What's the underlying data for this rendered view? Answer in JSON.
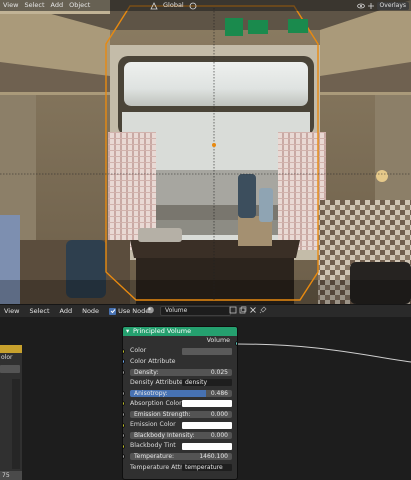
{
  "viewport_header": {
    "menus": [
      "View",
      "Select",
      "Add",
      "Object"
    ],
    "orientation": "Global",
    "overlays_label": "Overlays"
  },
  "node_editor": {
    "menus": [
      "View",
      "Select",
      "Add",
      "Node"
    ],
    "use_nodes_label": "Use Nodes",
    "material_name": "Volume"
  },
  "left_node": {
    "partial_label": "olor",
    "bottom_value": "75"
  },
  "node": {
    "title": "Principled Volume",
    "output": "Volume",
    "inputs": [
      {
        "label": "Color",
        "kind": "color",
        "swatch": "#5a5a5a"
      },
      {
        "label": "Color Attribute",
        "kind": "string-socket"
      },
      {
        "label": "Density:",
        "kind": "float",
        "value": "0.025"
      },
      {
        "label": "Density Attribute",
        "kind": "text",
        "value": "density"
      },
      {
        "label": "Anisotropy:",
        "kind": "slider",
        "value": "0.486",
        "fill": 0.743
      },
      {
        "label": "Absorption Color",
        "kind": "color",
        "swatch": "#ffffff"
      },
      {
        "label": "Emission Strength:",
        "kind": "float",
        "value": "0.000"
      },
      {
        "label": "Emission Color",
        "kind": "color",
        "swatch": "#ffffff"
      },
      {
        "label": "Blackbody Intensity:",
        "kind": "float",
        "value": "0.000"
      },
      {
        "label": "Blackbody Tint",
        "kind": "color",
        "swatch": "#ffffff"
      },
      {
        "label": "Temperature:",
        "kind": "float",
        "value": "1460.100"
      },
      {
        "label": "Temperature Attr...",
        "kind": "text",
        "value": "temperature"
      }
    ]
  },
  "colors": {
    "node_header": "#25a06f",
    "selection": "#e88a10",
    "slider_fill": "#4772b3"
  }
}
